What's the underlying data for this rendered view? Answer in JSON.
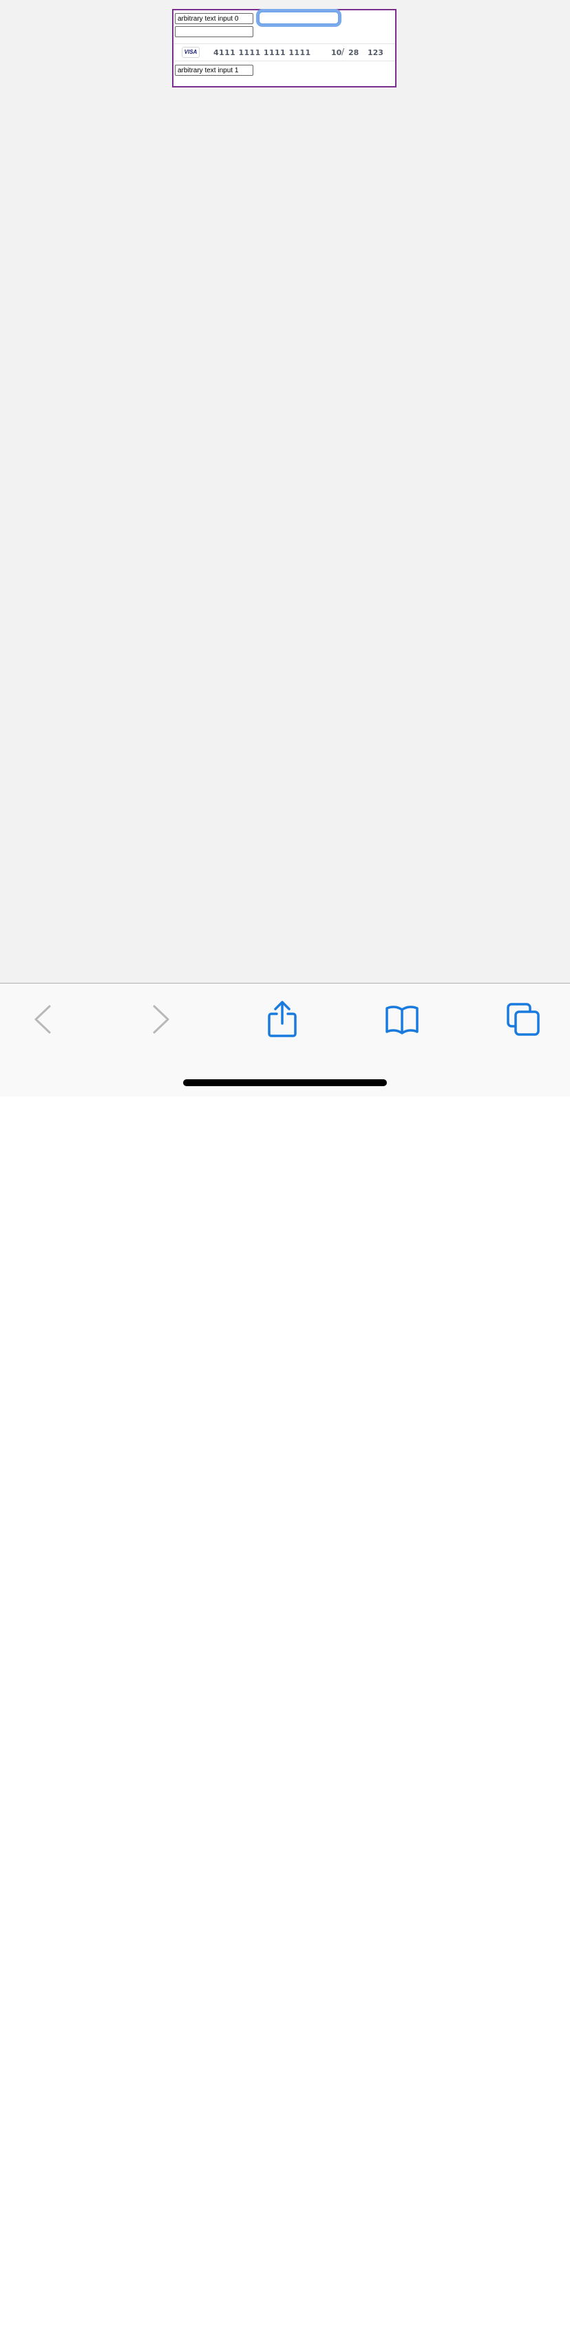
{
  "form": {
    "input0_value": "arbitrary text input 0",
    "input_focused_value": "",
    "input_empty_value": "",
    "input1_value": "arbitrary text input 1",
    "card": {
      "brand": "VISA",
      "number": "4111 1111 1111 1111",
      "exp_month": "10",
      "exp_separator": "/",
      "exp_year": "28",
      "cvc": "123"
    }
  },
  "toolbar": {
    "buttons": [
      {
        "icon": "chevron-left-icon",
        "enabled": false
      },
      {
        "icon": "chevron-right-icon",
        "enabled": false
      },
      {
        "icon": "share-icon",
        "enabled": true
      },
      {
        "icon": "bookmarks-icon",
        "enabled": true
      },
      {
        "icon": "tabs-icon",
        "enabled": true
      }
    ],
    "accent_color": "#1a7bdf",
    "disabled_color": "#b8b8b8"
  },
  "colors": {
    "frame_border": "#7b2f8c",
    "focus_ring": "#7aa9ec",
    "background": "#f2f2f2"
  }
}
